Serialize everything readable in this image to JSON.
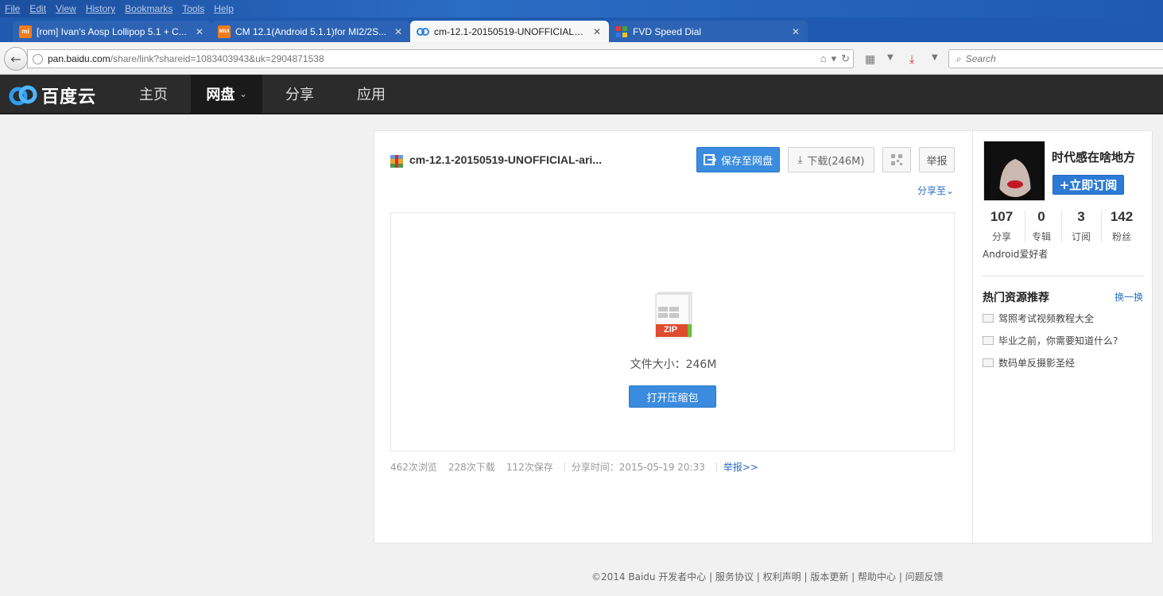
{
  "browser": {
    "menu": [
      "File",
      "Edit",
      "View",
      "History",
      "Bookmarks",
      "Tools",
      "Help"
    ],
    "tabs": [
      {
        "icon": "mi",
        "title": "[rom] Ivan's Aosp Lollipop 5.1 + C...",
        "active": false
      },
      {
        "icon": "MIUI",
        "title": "CM 12.1(Android 5.1.1)for MI2/2S...",
        "active": false
      },
      {
        "icon": "baidu-cloud",
        "title": "cm-12.1-20150519-UNOFFICIAL-ar...",
        "active": true
      },
      {
        "icon": "fvd",
        "title": "FVD Speed Dial",
        "active": false
      }
    ],
    "new_tab": "+",
    "url_host": "pan.baidu.com",
    "url_path": "/share/link?shareid=1083403943&uk=2904871538",
    "search_placeholder": "Search"
  },
  "baidu": {
    "logo": "百度云",
    "nav": [
      {
        "label": "主页",
        "active": false
      },
      {
        "label": "网盘",
        "active": true
      },
      {
        "label": "分享",
        "active": false
      },
      {
        "label": "应用",
        "active": false
      }
    ]
  },
  "file": {
    "title": "cm-12.1-20150519-UNOFFICIAL-ari...",
    "save_label": "保存至网盘",
    "download_label": "下载(246M)",
    "report_label": "举报",
    "share_to": "分享至",
    "zip_label": "ZIP",
    "size_text": "文件大小：246M",
    "open_label": "打开压缩包"
  },
  "stats": {
    "views": "462次浏览",
    "downloads": "228次下载",
    "saves": "112次保存",
    "share_time": "分享时间：2015-05-19 20:33",
    "report_link": "举报>>"
  },
  "profile": {
    "name": "时代感在啥地方",
    "subscribe": "立即订阅",
    "counts": [
      {
        "num": "107",
        "label": "分享"
      },
      {
        "num": "0",
        "label": "专辑"
      },
      {
        "num": "3",
        "label": "订阅"
      },
      {
        "num": "142",
        "label": "粉丝"
      }
    ],
    "desc": "Android爱好者"
  },
  "hot": {
    "title": "热门资源推荐",
    "refresh": "换一换",
    "items": [
      "驾照考试视频教程大全",
      "毕业之前，你需要知道什么?",
      "数码单反摄影圣经"
    ]
  },
  "footer": "©2014 Baidu 开发者中心 | 服务协议 | 权利声明 | 版本更新 | 帮助中心 | 问题反馈",
  "colors": {
    "accent": "#3b8cde",
    "header": "#2b2b2b",
    "link": "#2e6ec2"
  }
}
